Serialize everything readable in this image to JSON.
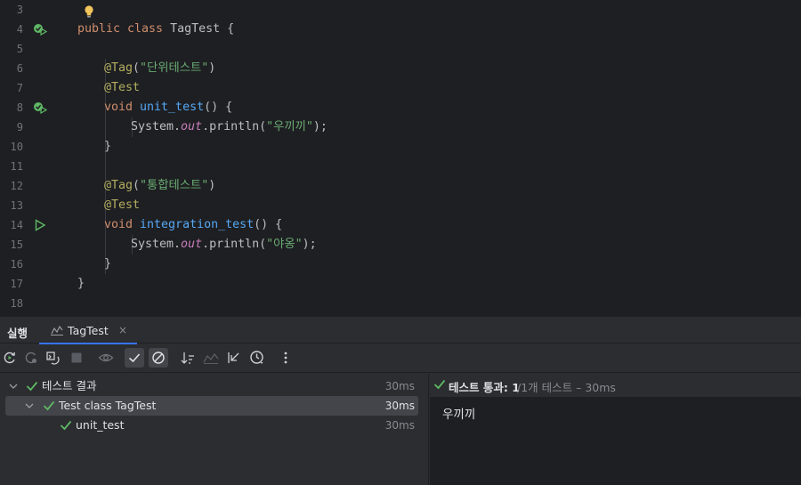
{
  "editor": {
    "line_numbers": [
      "3",
      "4",
      "5",
      "6",
      "7",
      "8",
      "9",
      "10",
      "11",
      "12",
      "13",
      "14",
      "15",
      "16",
      "17",
      "18"
    ],
    "code": {
      "l4_kw": "public class ",
      "l4_name": "TagTest {",
      "l6_ann": "@Tag",
      "l6_open": "(",
      "l6_str": "\"단위테스트\"",
      "l6_close": ")",
      "l7_ann": "@Test",
      "l8_kw": "void ",
      "l8_fn": "unit_test",
      "l8_rest": "() {",
      "l9_a": "System.",
      "l9_fld": "out",
      "l9_b": ".println(",
      "l9_str": "\"우끼끼\"",
      "l9_c": ");",
      "l10": "}",
      "l12_ann": "@Tag",
      "l12_open": "(",
      "l12_str": "\"통합테스트\"",
      "l12_close": ")",
      "l13_ann": "@Test",
      "l14_kw": "void ",
      "l14_fn": "integration_test",
      "l14_rest": "() {",
      "l15_a": "System.",
      "l15_fld": "out",
      "l15_b": ".println(",
      "l15_str": "\"야옹\"",
      "l15_c": ");",
      "l16": "}",
      "l17": "}"
    }
  },
  "run_panel": {
    "label": "실행",
    "tab_title": "TagTest",
    "tab_close": "×",
    "tree": [
      {
        "name": "테스트 결과",
        "time": "30ms"
      },
      {
        "name": "Test class TagTest",
        "time": "30ms"
      },
      {
        "name": "unit_test",
        "time": "30ms"
      }
    ],
    "status_main": "테스트 통과: 1",
    "status_sub": "/1개 테스트 – 30ms",
    "console_output": "우끼끼"
  },
  "colors": {
    "accent": "#3574f0",
    "pass_green": "#5fb865",
    "editor_bg": "#1e1f22",
    "panel_bg": "#2b2d30"
  },
  "icons": [
    "lightbulb-icon",
    "run-test-passed-icon",
    "run-test-icon",
    "rerun-icon",
    "rerun-failed-icon",
    "toggle-auto-test-icon",
    "stop-icon",
    "show-ignored-icon",
    "show-passed-icon",
    "show-ignored-toggle-icon",
    "sort-icon",
    "import-tests-icon",
    "collapse-icon",
    "history-icon",
    "more-icon"
  ]
}
